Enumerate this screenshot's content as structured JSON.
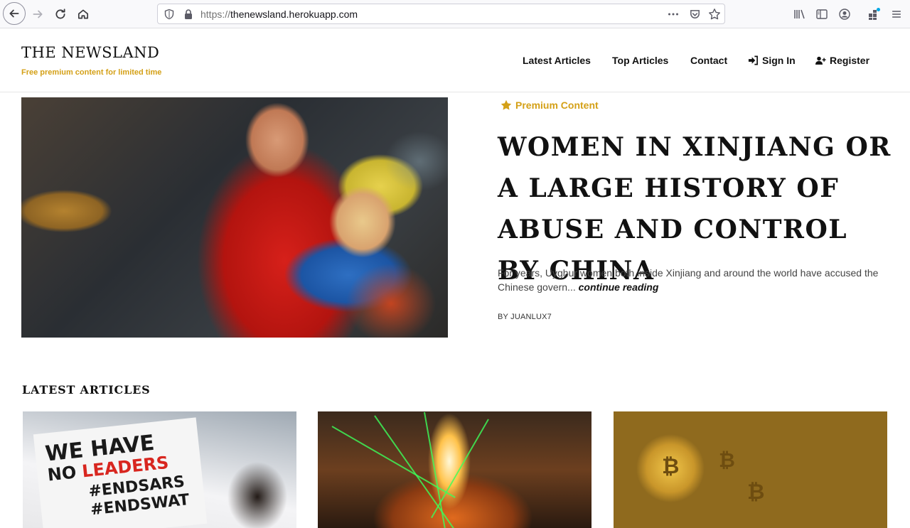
{
  "browser": {
    "url_protocol": "https://",
    "url_host": "thenewsland.herokuapp.com"
  },
  "site": {
    "brand": "THE NEWSLAND",
    "tagline": "Free premium content for limited time"
  },
  "nav": {
    "latest": "Latest Articles",
    "top": "Top Articles",
    "contact": "Contact",
    "signin": "Sign In",
    "register": "Register"
  },
  "featured": {
    "badge": "Premium Content",
    "title": "WOMEN IN XINJIANG OR A LARGE HISTORY OF ABUSE AND CONTROL BY CHINA",
    "excerpt": "For years, Uyghur women both inside Xinjiang and around the world have accused the Chinese govern...",
    "read_more": "continue reading",
    "byline": "BY JUANLUX7"
  },
  "latest": {
    "heading": "LATEST ARTICLES",
    "cards": [
      {
        "sign_line1": "WE HAVE",
        "sign_line2a": "NO ",
        "sign_line2b": "LEADERS",
        "sign_line3": "#ENDSARS",
        "sign_line4": "#ENDSWAT"
      },
      {},
      {}
    ]
  },
  "colors": {
    "accent": "#d4a017",
    "text": "#111111"
  }
}
